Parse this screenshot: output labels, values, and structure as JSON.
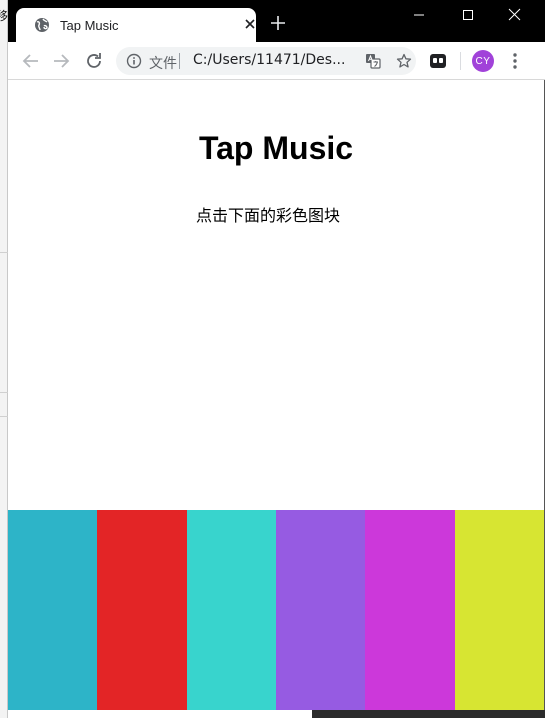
{
  "window": {
    "tab_title": "Tap Music"
  },
  "address_bar": {
    "scheme_label": "文件",
    "url": "C:/Users/11471/Des..."
  },
  "profile": {
    "initials": "CY",
    "color": "#a142d9"
  },
  "page": {
    "title": "Tap Music",
    "subtitle": "点击下面的彩色图块"
  },
  "pads": [
    {
      "color": "#2db4c8"
    },
    {
      "color": "#e32526"
    },
    {
      "color": "#38d4cd"
    },
    {
      "color": "#965be2"
    },
    {
      "color": "#cc38da"
    },
    {
      "color": "#d7e532"
    }
  ],
  "background": {
    "partial_char": "移"
  }
}
